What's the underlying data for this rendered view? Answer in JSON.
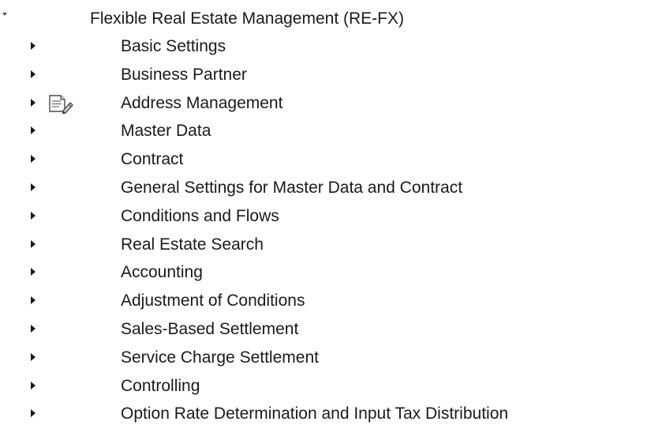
{
  "tree": {
    "root": {
      "label": "Flexible Real Estate Management (RE-FX)"
    },
    "items": [
      {
        "label": "Basic Settings",
        "has_icon": false
      },
      {
        "label": "Business Partner",
        "has_icon": false
      },
      {
        "label": "Address Management",
        "has_icon": true,
        "icon": "document-edit-icon"
      },
      {
        "label": "Master Data",
        "has_icon": false
      },
      {
        "label": "Contract",
        "has_icon": false
      },
      {
        "label": "General Settings for Master Data and Contract",
        "has_icon": false
      },
      {
        "label": "Conditions and Flows",
        "has_icon": false
      },
      {
        "label": "Real Estate Search",
        "has_icon": false
      },
      {
        "label": "Accounting",
        "has_icon": false
      },
      {
        "label": "Adjustment of Conditions",
        "has_icon": false
      },
      {
        "label": "Sales-Based Settlement",
        "has_icon": false
      },
      {
        "label": "Service Charge Settlement",
        "has_icon": false
      },
      {
        "label": "Controlling",
        "has_icon": false
      },
      {
        "label": "Option Rate Determination and Input Tax Distribution",
        "has_icon": false
      }
    ]
  }
}
